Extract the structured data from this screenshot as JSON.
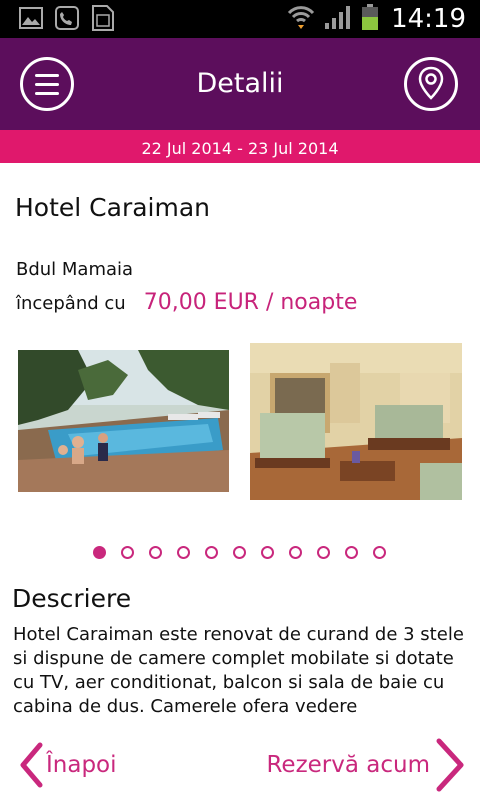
{
  "status_bar": {
    "time": "14:19",
    "icons": [
      "image-icon",
      "sip-call-icon",
      "sim-icon",
      "wifi-icon",
      "signal-icon",
      "battery-icon"
    ]
  },
  "header": {
    "title": "Detalii",
    "menu_icon": "menu-icon",
    "map_icon": "map-pin-icon"
  },
  "date_range": "22 Jul 2014 - 23 Jul 2014",
  "hotel": {
    "name": "Hotel Caraiman",
    "address": "Bdul Mamaia",
    "price_label": "începând cu",
    "price_value": "70,00 EUR / noapte"
  },
  "gallery": {
    "photos": [
      "pool-photo",
      "lobby-photo"
    ],
    "page_count": 11,
    "active_index": 0
  },
  "description": {
    "title": "Descriere",
    "text": "Hotel Caraiman este renovat de curand de 3 stele si dispune de camere complet mobilate si dotate cu TV, aer conditionat, balcon si sala de baie cu cabina de dus. Camerele ofera vedere"
  },
  "footer": {
    "back_label": "Înapoi",
    "book_label": "Rezervă acum"
  },
  "colors": {
    "header_bg": "#5c0e5c",
    "date_bar_bg": "#e0186c",
    "accent": "#c9287d",
    "price": "#c7237a"
  }
}
